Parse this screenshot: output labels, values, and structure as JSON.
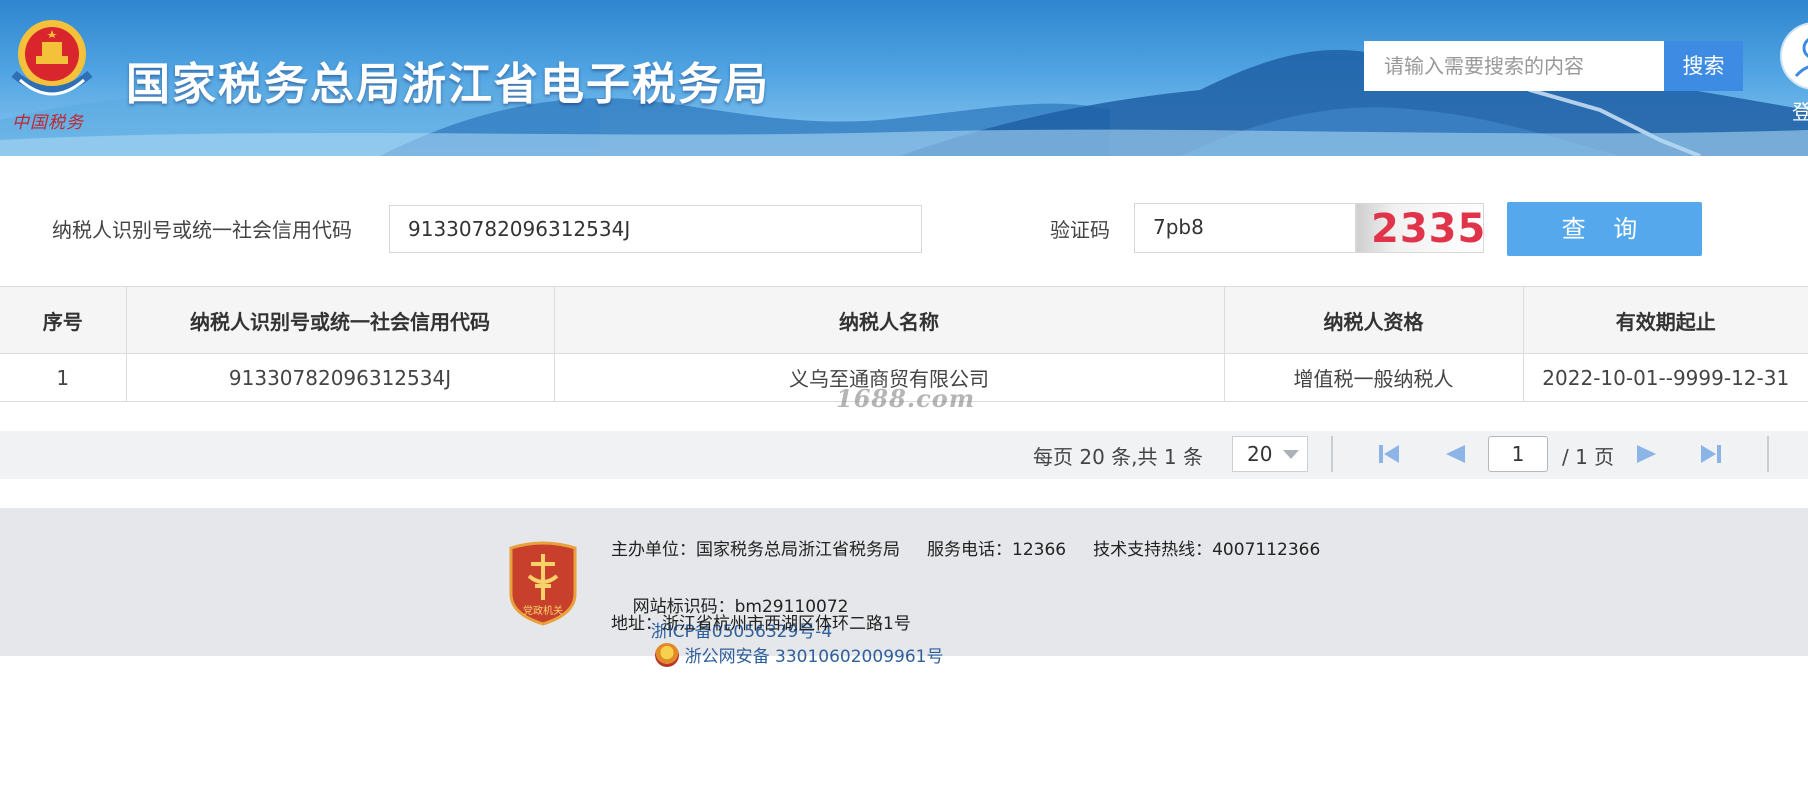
{
  "header": {
    "emblem_caption": "中国税务",
    "site_title": "国家税务总局浙江省电子税务局",
    "search_placeholder": "请输入需要搜索的内容",
    "search_button": "搜索",
    "login_label": "登"
  },
  "form": {
    "taxpayer_id_label": "纳税人识别号或统一社会信用代码",
    "taxpayer_id_value": "91330782096312534J",
    "captcha_label": "验证码",
    "captcha_value": "7pb8",
    "captcha_image_text": "2335",
    "query_button": "查 询"
  },
  "table": {
    "headers": [
      "序号",
      "纳税人识别号或统一社会信用代码",
      "纳税人名称",
      "纳税人资格",
      "有效期起止"
    ],
    "rows": [
      [
        "1",
        "91330782096312534J",
        "义乌至通商贸有限公司",
        "增值税一般纳税人",
        "2022-10-01--9999-12-31"
      ]
    ]
  },
  "watermark": "1688.com",
  "pager": {
    "info": "每页 20 条,共 1 条",
    "page_size": "20",
    "current_page": "1",
    "total_pages": "/ 1 页"
  },
  "footer": {
    "badge_text": "党政机关",
    "line1": "主办单位：国家税务总局浙江省税务局     服务电话：12366     技术支持热线：4007112366",
    "site_code": "网站标识码：bm29110072",
    "icp": "浙ICP备05056329号-4",
    "police_record": "浙公网安备 33010602009961号",
    "address": "地址：浙江省杭州市西湖区体环二路1号"
  }
}
